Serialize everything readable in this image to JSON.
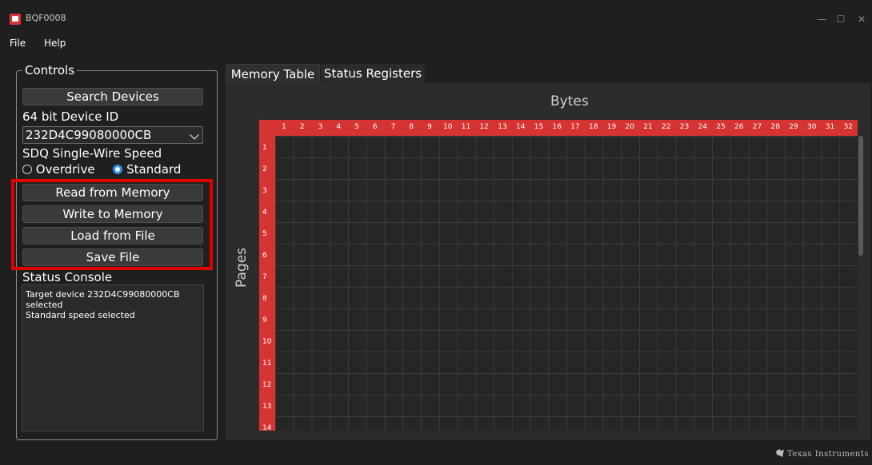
{
  "window": {
    "title": "BQF0008",
    "minimize": "—",
    "maximize": "☐",
    "close": "✕"
  },
  "menu": {
    "file": "File",
    "help": "Help"
  },
  "controls": {
    "group_title": "Controls",
    "search_button": "Search Devices",
    "device_id_label": "64 bit Device ID",
    "device_id_value": "232D4C99080000CB",
    "speed_label": "SDQ Single-Wire Speed",
    "radio_overdrive": "Overdrive",
    "radio_standard": "Standard",
    "selected_speed": "Standard",
    "read_button": "Read from Memory",
    "write_button": "Write to Memory",
    "load_button": "Load from File",
    "save_button": "Save File",
    "console_label": "Status Console",
    "console_text": "Target device 232D4C99080000CB\nselected\nStandard speed selected"
  },
  "tabs": [
    {
      "label": "Memory Table",
      "active": true
    },
    {
      "label": "Status Registers",
      "active": false
    }
  ],
  "memory_table": {
    "columns_label": "Bytes",
    "rows_label": "Pages",
    "columns": [
      "1",
      "2",
      "3",
      "4",
      "5",
      "6",
      "7",
      "8",
      "9",
      "10",
      "11",
      "12",
      "13",
      "14",
      "15",
      "16",
      "17",
      "18",
      "19",
      "20",
      "21",
      "22",
      "23",
      "24",
      "25",
      "26",
      "27",
      "28",
      "29",
      "30",
      "31",
      "32"
    ],
    "rows": [
      "1",
      "2",
      "3",
      "4",
      "5",
      "6",
      "7",
      "8",
      "9",
      "10",
      "11",
      "12",
      "13",
      "14"
    ]
  },
  "footer": {
    "brand": "Texas Instruments"
  },
  "colors": {
    "accent_red": "#d63333",
    "highlight_red": "#e00000",
    "radio_blue": "#2f8ff0"
  }
}
